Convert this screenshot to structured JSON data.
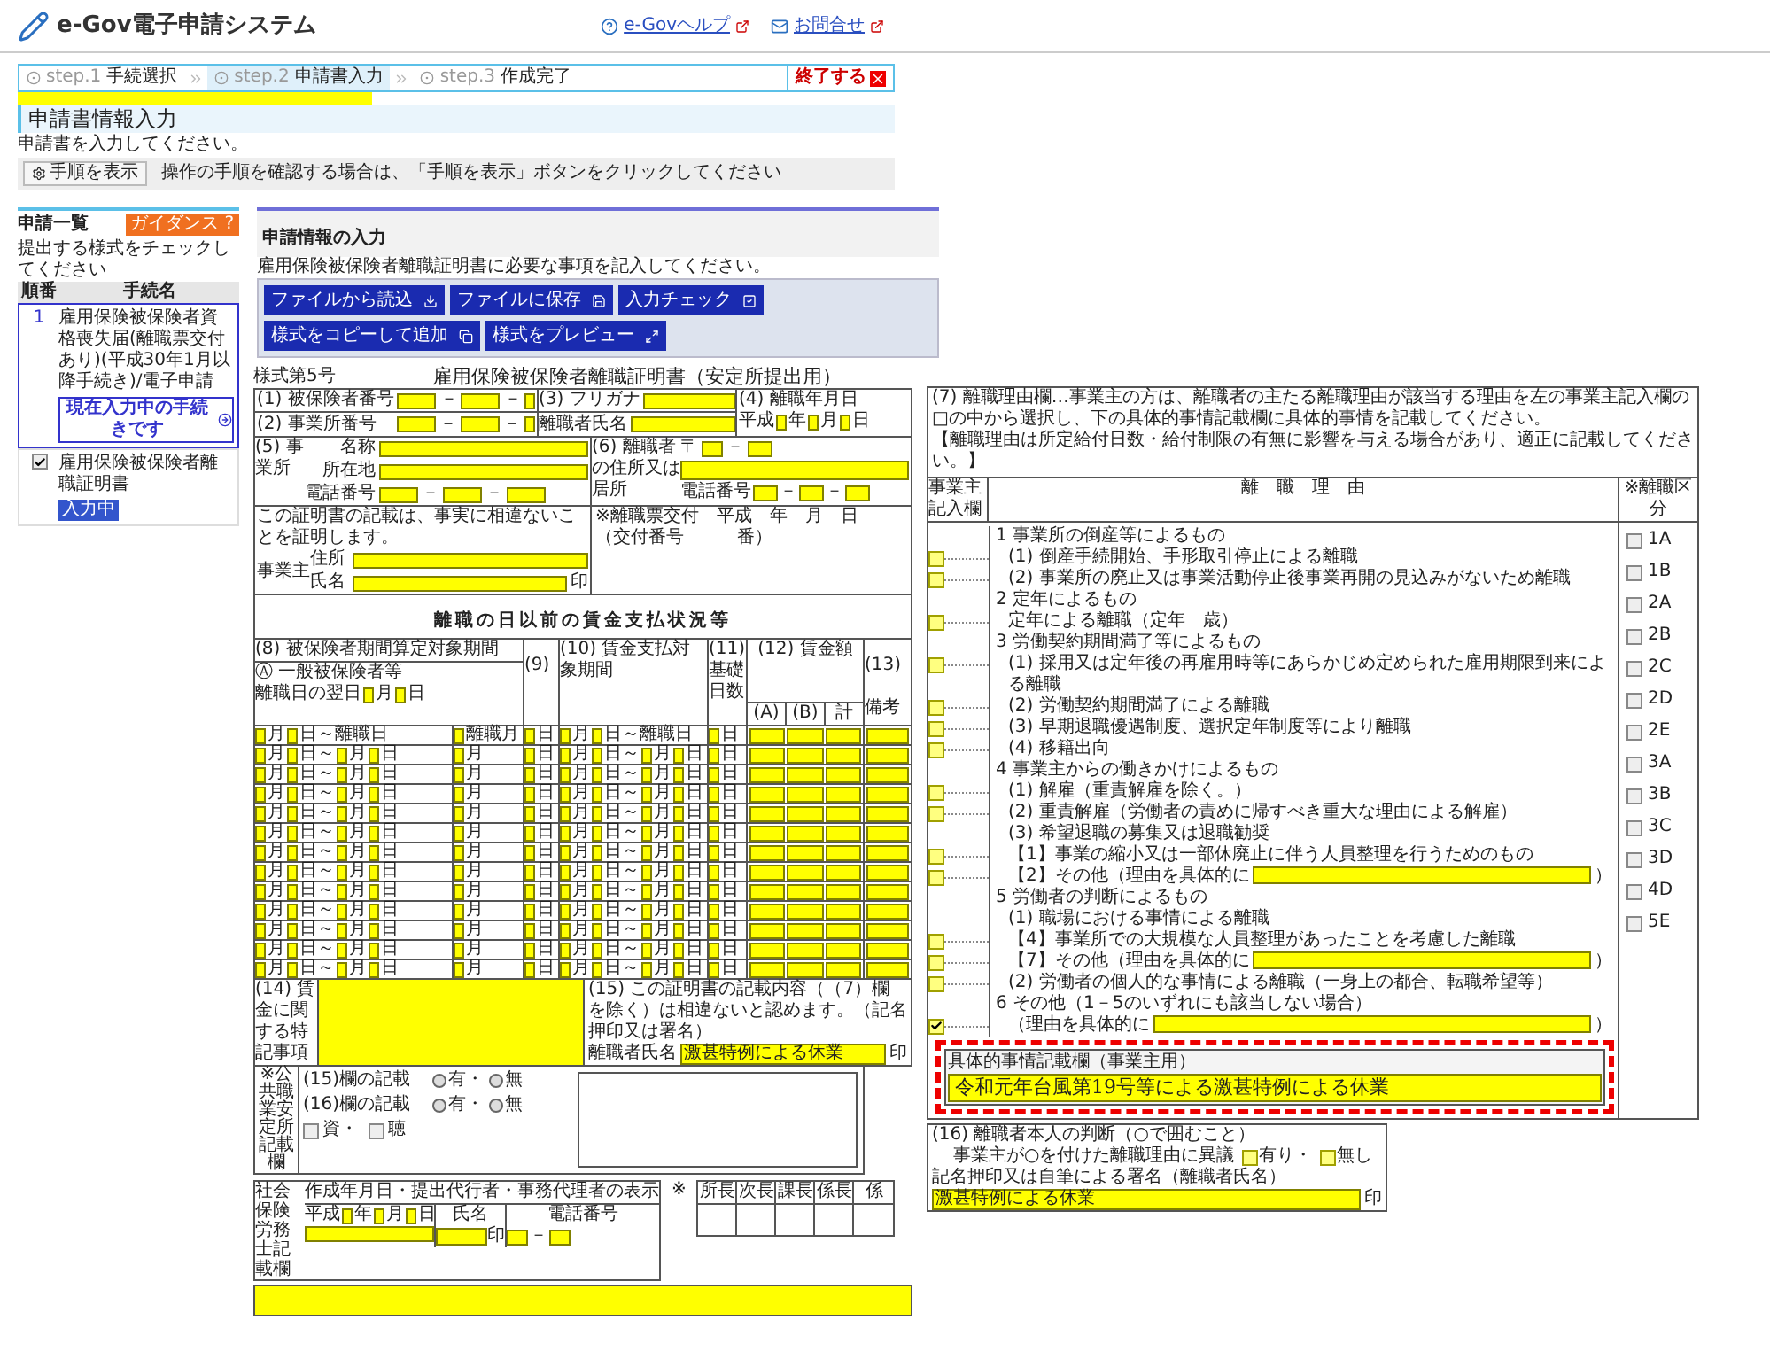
{
  "header": {
    "title": "e-Gov電子申請システム",
    "links": [
      "e-Govヘルプ",
      "お問合せ"
    ]
  },
  "steps": [
    {
      "step": "step.1",
      "label": "手続選択",
      "selected": false
    },
    {
      "step": "step.2",
      "label": "申請書入力",
      "selected": true
    },
    {
      "step": "step.3",
      "label": "作成完了",
      "selected": false
    }
  ],
  "exit_button": "終了する",
  "page_title": "申請書情報入力",
  "intro": "申請書を入力してください。",
  "guide": {
    "button": "手順を表示",
    "text": "操作の手順を確認する場合は、「手順を表示」ボタンをクリックしてください"
  },
  "list_panel": {
    "title": "申請一覧",
    "guidance": "ガイダンス",
    "guidance_mark": "?",
    "hint": "提出する様式をチェックしてください",
    "columns": [
      "順番",
      "手続名"
    ],
    "rows": [
      {
        "kind": "number",
        "no": "1",
        "name": "雇用保険被保険者資格喪失届(離職票交付あり)(平成30年1月以降手続き)/電子申請",
        "button": "現在入力中の手続きです"
      },
      {
        "kind": "checkbox",
        "checked": true,
        "name": "雇用保険被保険者離職証明書",
        "badge": "入力中"
      }
    ]
  },
  "input_panel": {
    "title": "申請情報の入力",
    "description": "雇用保険被保険者離職証明書に必要な事項を記入してください。",
    "buttons": [
      "ファイルから読込",
      "ファイルに保存",
      "入力チェック",
      "様式をコピーして追加",
      "様式をプレビュー"
    ]
  },
  "form_left": {
    "form_no": "様式第5号",
    "title": "雇用保険被保険者離職証明書（安定所提出用）",
    "insured_number": "(1) 被保険者番号",
    "office_number": "(2) 事業所番号",
    "dash": "－",
    "kana": "(3) フリガナ",
    "name": "離職者氏名",
    "date_label": "(4) 離職年月日",
    "era": "平成",
    "date_units": [
      "年",
      "月",
      "日"
    ],
    "employer_label": "(5) 事業所",
    "employer_fields": [
      "名称",
      "所在地",
      "電話番号"
    ],
    "address_label": "(6) 離職者の住所又は居所",
    "postal": "〒",
    "phone": "電話番号",
    "certify_text": "この証明書の記載は、事実に相違ないことを証明します。",
    "certify_label": "事業主",
    "certify_fields": [
      "住所",
      "氏名"
    ],
    "certify_seal": "印",
    "office_lines": [
      "※離職票交付　平成　年　月　日",
      "（交付番号　　　番）"
    ],
    "wage_title": "離職の日以前の賃金支払状況等",
    "head_8": "(8) 被保険者期間算定対象期間",
    "head_a": "Ⓐ 一般被保険者等",
    "next_day": "離職日の翌日",
    "next_day_units": [
      "月",
      "日"
    ],
    "head_9": "(9)",
    "head_10": "(10) 賃金支払対象期間",
    "head_11": "(11)",
    "head_11b": "基礎日数",
    "head_12": "(12) 賃金額",
    "wage_cols": [
      "(A)",
      "(B)",
      "計"
    ],
    "head_13": "(13) 備考",
    "rows": [
      {
        "a": [
          "月",
          "日～離職日"
        ],
        "b": "離職月",
        "c": "日",
        "d": [
          "月",
          "日～離職日"
        ],
        "e": "日"
      },
      {
        "a": [
          "月",
          "日～",
          "月",
          "日"
        ],
        "b": "月",
        "c": "日",
        "d": [
          "月",
          "日～",
          "月",
          "日"
        ],
        "e": "日"
      },
      {
        "a": [
          "月",
          "日～",
          "月",
          "日"
        ],
        "b": "月",
        "c": "日",
        "d": [
          "月",
          "日～",
          "月",
          "日"
        ],
        "e": "日"
      },
      {
        "a": [
          "月",
          "日～",
          "月",
          "日"
        ],
        "b": "月",
        "c": "日",
        "d": [
          "月",
          "日～",
          "月",
          "日"
        ],
        "e": "日"
      },
      {
        "a": [
          "月",
          "日～",
          "月",
          "日"
        ],
        "b": "月",
        "c": "日",
        "d": [
          "月",
          "日～",
          "月",
          "日"
        ],
        "e": "日"
      },
      {
        "a": [
          "月",
          "日～",
          "月",
          "日"
        ],
        "b": "月",
        "c": "日",
        "d": [
          "月",
          "日～",
          "月",
          "日"
        ],
        "e": "日"
      },
      {
        "a": [
          "月",
          "日～",
          "月",
          "日"
        ],
        "b": "月",
        "c": "日",
        "d": [
          "月",
          "日～",
          "月",
          "日"
        ],
        "e": "日"
      },
      {
        "a": [
          "月",
          "日～",
          "月",
          "日"
        ],
        "b": "月",
        "c": "日",
        "d": [
          "月",
          "日～",
          "月",
          "日"
        ],
        "e": "日"
      },
      {
        "a": [
          "月",
          "日～",
          "月",
          "日"
        ],
        "b": "月",
        "c": "日",
        "d": [
          "月",
          "日～",
          "月",
          "日"
        ],
        "e": "日"
      },
      {
        "a": [
          "月",
          "日～",
          "月",
          "日"
        ],
        "b": "月",
        "c": "日",
        "d": [
          "月",
          "日～",
          "月",
          "日"
        ],
        "e": "日"
      },
      {
        "a": [
          "月",
          "日～",
          "月",
          "日"
        ],
        "b": "月",
        "c": "日",
        "d": [
          "月",
          "日～",
          "月",
          "日"
        ],
        "e": "日"
      },
      {
        "a": [
          "月",
          "日～",
          "月",
          "日"
        ],
        "b": "月",
        "c": "日",
        "d": [
          "月",
          "日～",
          "月",
          "日"
        ],
        "e": "日"
      },
      {
        "a": [
          "月",
          "日～",
          "月",
          "日"
        ],
        "b": "月",
        "c": "日",
        "d": [
          "月",
          "日～",
          "月",
          "日"
        ],
        "e": "日"
      }
    ],
    "notes_label": "(14) 賃金に関する特記事項",
    "confirm_text": "(15) この証明書の記載内容（（7）欄を除く）は相違ないと認めます。（記名押印又は署名）",
    "confirm_label": "離職者氏名",
    "confirm_value": "激甚特例による休業",
    "confirm_seal": "印",
    "office_label": "※公共職業安定所記載欄",
    "office_radios": [
      {
        "label": "(15)欄の記載",
        "options": [
          {
            "label": "有・",
            "selected": false
          },
          {
            "label": "無",
            "selected": false
          }
        ]
      },
      {
        "label": "(16)欄の記載",
        "options": [
          {
            "label": "有・",
            "selected": false
          },
          {
            "label": "無",
            "selected": false
          }
        ]
      }
    ],
    "office_checks": [
      {
        "label": "資・",
        "checked": false
      },
      {
        "label": "聴",
        "checked": false
      }
    ],
    "agent_label": "社会保険労務士記載欄",
    "agent_era": "平成",
    "agent_date_units": [
      "年",
      "月",
      "日"
    ],
    "agent_seal": "印",
    "agent_columns": [
      "作成年月日・提出代行者・事務代理者の表示",
      "氏名",
      "電話番号"
    ],
    "staff_mark": "※",
    "staff_columns": [
      "所長",
      "次長",
      "課長",
      "係長",
      "係"
    ]
  },
  "form_right": {
    "intro": "(7) 離職理由欄…事業主の方は、離職者の主たる離職理由が該当する理由を左の事業主記入欄の□の中から選択し、下の具体的事情記載欄に具体的事情を記載してください。",
    "note": "【離職理由は所定給付日数・給付制限の有無に影響を与える場合があり、適正に記載してください。】",
    "columns": [
      "事業主記入欄",
      "離　職　理　由",
      "※離職区分"
    ],
    "codes": [
      {
        "label": "1A",
        "checked": false
      },
      {
        "label": "1B",
        "checked": false
      },
      {
        "label": "2A",
        "checked": false
      },
      {
        "label": "2B",
        "checked": false
      },
      {
        "label": "2C",
        "checked": false
      },
      {
        "label": "2D",
        "checked": false
      },
      {
        "label": "2E",
        "checked": false
      },
      {
        "label": "3A",
        "checked": false
      },
      {
        "label": "3B",
        "checked": false
      },
      {
        "label": "3C",
        "checked": false
      },
      {
        "label": "3D",
        "checked": false
      },
      {
        "label": "4D",
        "checked": false
      },
      {
        "label": "5E",
        "checked": false
      }
    ],
    "reasons": [
      {
        "kind": "heading",
        "text": "1 事業所の倒産等によるもの"
      },
      {
        "kind": "item",
        "text": "(1) 倒産手続開始、手形取引停止による離職",
        "checked": false
      },
      {
        "kind": "item",
        "text": "(2) 事業所の廃止又は事業活動停止後事業再開の見込みがないため離職",
        "checked": false
      },
      {
        "kind": "heading",
        "text": "2 定年によるもの"
      },
      {
        "kind": "item",
        "text": "定年による離職（定年　歳）",
        "checked": false
      },
      {
        "kind": "heading",
        "text": "3 労働契約期間満了等によるもの"
      },
      {
        "kind": "item",
        "text": "(1) 採用又は定年後の再雇用時等にあらかじめ定められた雇用期限到来による離職",
        "checked": false
      },
      {
        "kind": "item",
        "text": "(2) 労働契約期間満了による離職",
        "checked": false
      },
      {
        "kind": "item",
        "text": "(3) 早期退職優遇制度、選択定年制度等により離職",
        "checked": false
      },
      {
        "kind": "item",
        "text": "(4) 移籍出向",
        "checked": false
      },
      {
        "kind": "heading",
        "text": "4 事業主からの働きかけによるもの"
      },
      {
        "kind": "item",
        "text": "(1) 解雇（重責解雇を除く。）",
        "checked": false
      },
      {
        "kind": "item",
        "text": "(2) 重責解雇（労働者の責めに帰すべき重大な理由による解雇）",
        "checked": false
      },
      {
        "kind": "plain",
        "text": "(3) 希望退職の募集又は退職勧奨"
      },
      {
        "kind": "item",
        "text": "【1】事業の縮小又は一部休廃止に伴う人員整理を行うためのもの",
        "checked": false
      },
      {
        "kind": "field",
        "text": "【2】その他（理由を具体的に",
        "checked": false
      },
      {
        "kind": "heading",
        "text": "5 労働者の判断によるもの"
      },
      {
        "kind": "plain",
        "text": "(1) 職場における事情による離職"
      },
      {
        "kind": "item",
        "text": "【4】事業所での大規模な人員整理があったことを考慮した離職",
        "checked": false
      },
      {
        "kind": "field",
        "text": "【7】その他（理由を具体的に",
        "checked": false
      },
      {
        "kind": "item",
        "text": "(2) 労働者の個人的な事情による離職（一身上の都合、転職希望等）",
        "checked": false
      },
      {
        "kind": "heading",
        "text": "6 その他（1－5のいずれにも該当しない場合）"
      },
      {
        "kind": "field",
        "text": "（理由を具体的に",
        "checked": true
      }
    ],
    "close": "）",
    "detail_label": "具体的事情記載欄（事業主用）",
    "detail_value": "令和元年台風第19号等による激甚特例による休業"
  },
  "judgment": {
    "title": "(16) 離職者本人の判断（○で囲むこと）",
    "question": "事業主が○を付けた離職理由に異議",
    "options": [
      {
        "label": "有り・",
        "selected": false
      },
      {
        "label": "無し",
        "selected": false
      }
    ],
    "signature_label": "記名押印又は自筆による署名（離職者氏名）",
    "signature": "激甚特例による休業",
    "seal": "印"
  }
}
